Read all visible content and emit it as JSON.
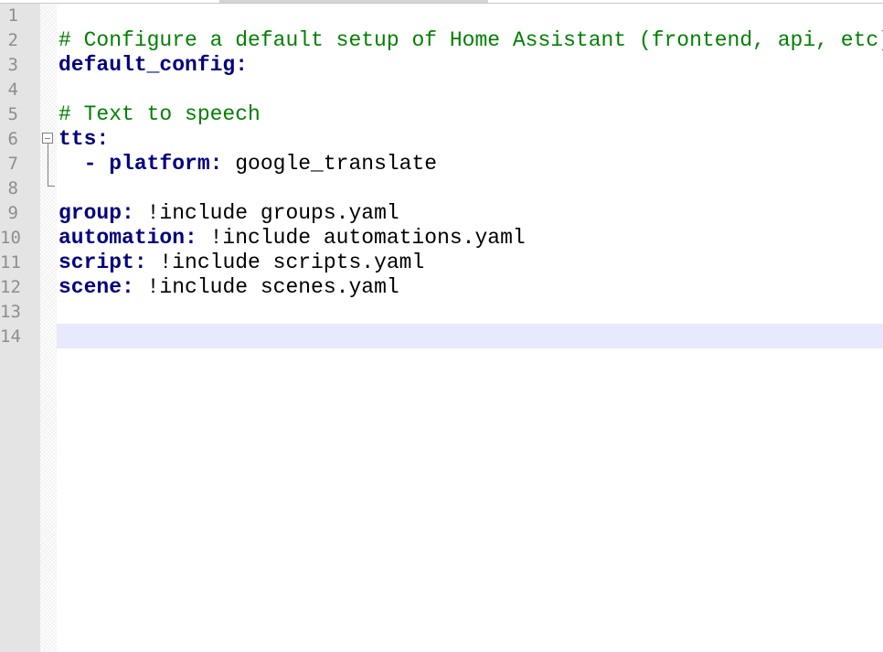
{
  "editor": {
    "line_numbers": [
      "1",
      "2",
      "3",
      "4",
      "5",
      "6",
      "7",
      "8",
      "9",
      "10",
      "11",
      "12",
      "13",
      "14"
    ],
    "current_line": "14",
    "lines": [
      {
        "num": "1",
        "segments": []
      },
      {
        "num": "2",
        "segments": [
          {
            "type": "comment",
            "text": "# Configure a default setup of Home Assistant (frontend, api, etc)"
          }
        ]
      },
      {
        "num": "3",
        "segments": [
          {
            "type": "key",
            "text": "default_config:"
          }
        ]
      },
      {
        "num": "4",
        "segments": []
      },
      {
        "num": "5",
        "segments": [
          {
            "type": "comment",
            "text": "# Text to speech"
          }
        ]
      },
      {
        "num": "6",
        "segments": [
          {
            "type": "key",
            "text": "tts:"
          }
        ]
      },
      {
        "num": "7",
        "segments": [
          {
            "type": "key",
            "text": "  - platform:"
          },
          {
            "type": "plain",
            "text": " google_translate"
          }
        ]
      },
      {
        "num": "8",
        "segments": []
      },
      {
        "num": "9",
        "segments": [
          {
            "type": "key",
            "text": "group:"
          },
          {
            "type": "plain",
            "text": " !include groups.yaml"
          }
        ]
      },
      {
        "num": "10",
        "segments": [
          {
            "type": "key",
            "text": "automation:"
          },
          {
            "type": "plain",
            "text": " !include automations.yaml"
          }
        ]
      },
      {
        "num": "11",
        "segments": [
          {
            "type": "key",
            "text": "script:"
          },
          {
            "type": "plain",
            "text": " !include scripts.yaml"
          }
        ]
      },
      {
        "num": "12",
        "segments": [
          {
            "type": "key",
            "text": "scene:"
          },
          {
            "type": "plain",
            "text": " !include scenes.yaml"
          }
        ]
      },
      {
        "num": "13",
        "segments": []
      },
      {
        "num": "14",
        "segments": []
      }
    ]
  },
  "colors": {
    "comment": "#008000",
    "key": "#000080",
    "plain": "#000000",
    "line_number": "#8e8e8e",
    "gutter_bg": "#e4e4e4",
    "current_line_bg": "#e8e8ff"
  },
  "icons": {
    "fold_toggle": "minus-box-icon"
  }
}
